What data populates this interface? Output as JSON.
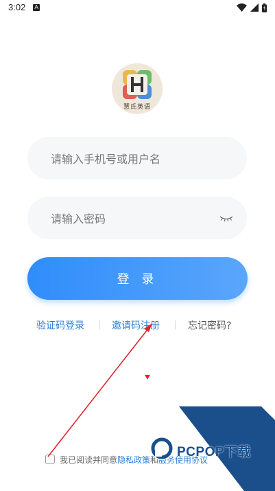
{
  "status_bar": {
    "time": "3:02",
    "notification_badge": "A"
  },
  "logo": {
    "caption": "慧氏英语",
    "letter": "H"
  },
  "phone_field": {
    "placeholder": "请输入手机号或用户名",
    "value": ""
  },
  "password_field": {
    "placeholder": "请输入密码",
    "value": ""
  },
  "login_button": {
    "label": "登 录"
  },
  "links": {
    "sms_login": "验证码登录",
    "invite_register": "邀请码注册",
    "forgot_password": "忘记密码?"
  },
  "agreement": {
    "prefix": "我已阅读并同意",
    "privacy": "隐私政策",
    "and": "和",
    "service": "服务使用协议"
  },
  "watermark": {
    "text": "PCPOP下载"
  },
  "colors": {
    "accent": "#2f8dfb",
    "link": "#2f7fd6",
    "field_bg": "#f6f7f9",
    "annotation": "#e0242c",
    "watermark": "#1a4f8c"
  }
}
